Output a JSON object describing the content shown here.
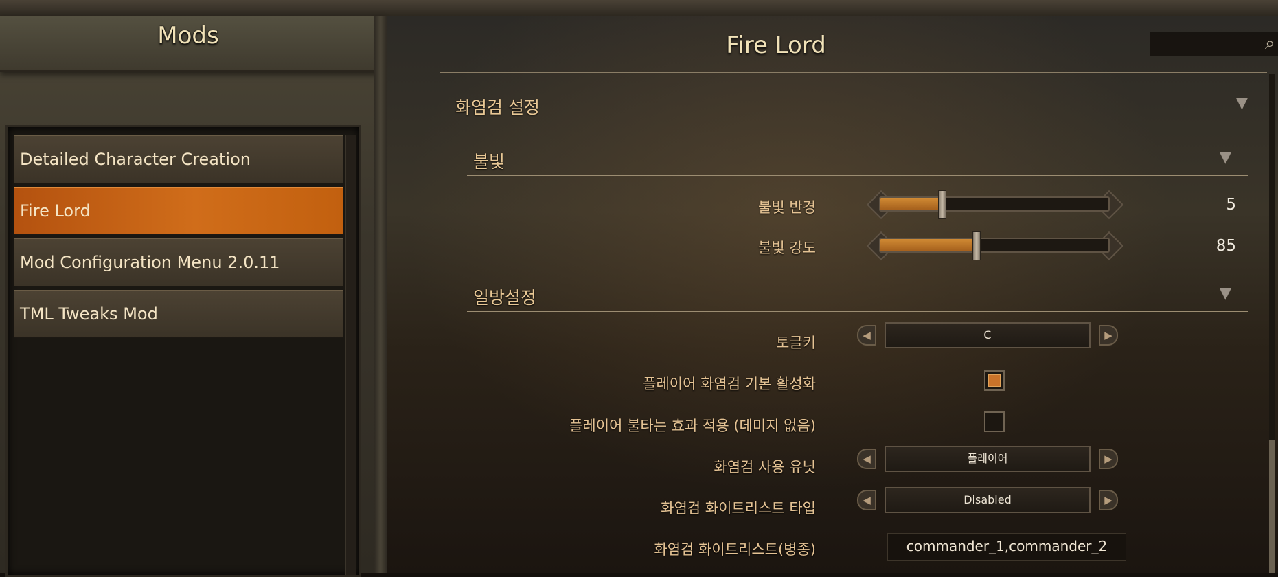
{
  "sidebar": {
    "title": "Mods",
    "items": [
      {
        "label": "Detailed Character Creation",
        "selected": false
      },
      {
        "label": "Fire Lord",
        "selected": true
      },
      {
        "label": "Mod Configuration Menu 2.0.11",
        "selected": false
      },
      {
        "label": "TML Tweaks Mod",
        "selected": false
      }
    ]
  },
  "main": {
    "title": "Fire Lord",
    "search": {
      "icon": "search-icon"
    },
    "group": {
      "title": "화염검 설정",
      "sections": [
        {
          "title": "불빛",
          "settings": [
            {
              "label": "불빛 반경",
              "type": "slider",
              "value": "5",
              "fill_fraction": 0.27
            },
            {
              "label": "불빛 강도",
              "type": "slider",
              "value": "85",
              "fill_fraction": 0.42
            }
          ]
        },
        {
          "title": "일방설정",
          "settings": [
            {
              "label": "토글키",
              "type": "dropdown",
              "value": "C"
            },
            {
              "label": "플레이어 화염검 기본 활성화",
              "type": "checkbox",
              "checked": true
            },
            {
              "label": "플레이어 불타는 효과 적용 (데미지 없음)",
              "type": "checkbox",
              "checked": false
            },
            {
              "label": "화염검 사용 유닛",
              "type": "dropdown",
              "value": "플레이어"
            },
            {
              "label": "화염검 화이트리스트 타입",
              "type": "dropdown",
              "value": "Disabled"
            },
            {
              "label": "화염검 화이트리스트(병종)",
              "type": "text",
              "value": "commander_1,commander_2"
            }
          ]
        }
      ]
    }
  },
  "colors": {
    "accent": "#c9732a",
    "selected_item": "#c2600f",
    "label_text": "#e5c394"
  }
}
